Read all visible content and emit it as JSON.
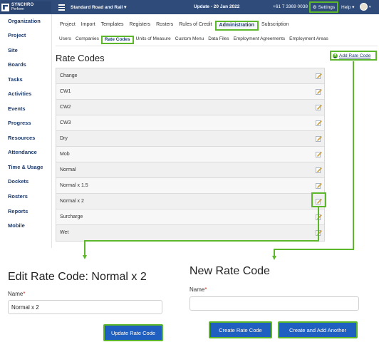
{
  "topbar": {
    "logo_line1": "SYNCHRO",
    "logo_line2": "Perform",
    "project": "Standard Road and Rail ▾",
    "update": "Update - 20 Jan 2022",
    "phone": "+61 7 3369 0038",
    "settings": "Settings",
    "help": "Help ▾"
  },
  "sidebar": {
    "items": [
      "Organization",
      "Project",
      "Site",
      "Boards",
      "Tasks",
      "Activities",
      "Events",
      "Progress",
      "Resources",
      "Attendance",
      "Time & Usage",
      "Dockets",
      "Rosters",
      "Reports",
      "Mobile"
    ]
  },
  "nav": {
    "primary": [
      "Project",
      "Import",
      "Templates",
      "Registers",
      "Rosters",
      "Rules of Credit",
      "Administration",
      "Subscription"
    ],
    "primary_active": "Administration",
    "secondary": [
      "Users",
      "Companies",
      "Rate Codes",
      "Units of Measure",
      "Custom Menu",
      "Data Files",
      "Employment Agreements",
      "Employment Areas"
    ],
    "secondary_active": "Rate Codes"
  },
  "page": {
    "title": "Rate Codes",
    "add_link": "Add Rate Code"
  },
  "rate_codes": [
    "Change",
    "CW1",
    "CW2",
    "CW3",
    "Dry",
    "Mob",
    "Normal",
    "Normal x 1.5",
    "Normal x 2",
    "Surcharge",
    "Wet"
  ],
  "edit_form": {
    "title": "Edit Rate Code: Normal x 2",
    "name_label": "Name",
    "required_mark": "*",
    "name_value": "Normal x 2",
    "update_button": "Update Rate Code"
  },
  "new_form": {
    "title": "New Rate Code",
    "name_label": "Name",
    "required_mark": "*",
    "name_value": "",
    "create_button": "Create Rate Code",
    "create_another_button": "Create and Add Another"
  },
  "colors": {
    "topbar": "#2f4b79",
    "highlight": "#5cb82a",
    "button": "#1f5fbf"
  }
}
